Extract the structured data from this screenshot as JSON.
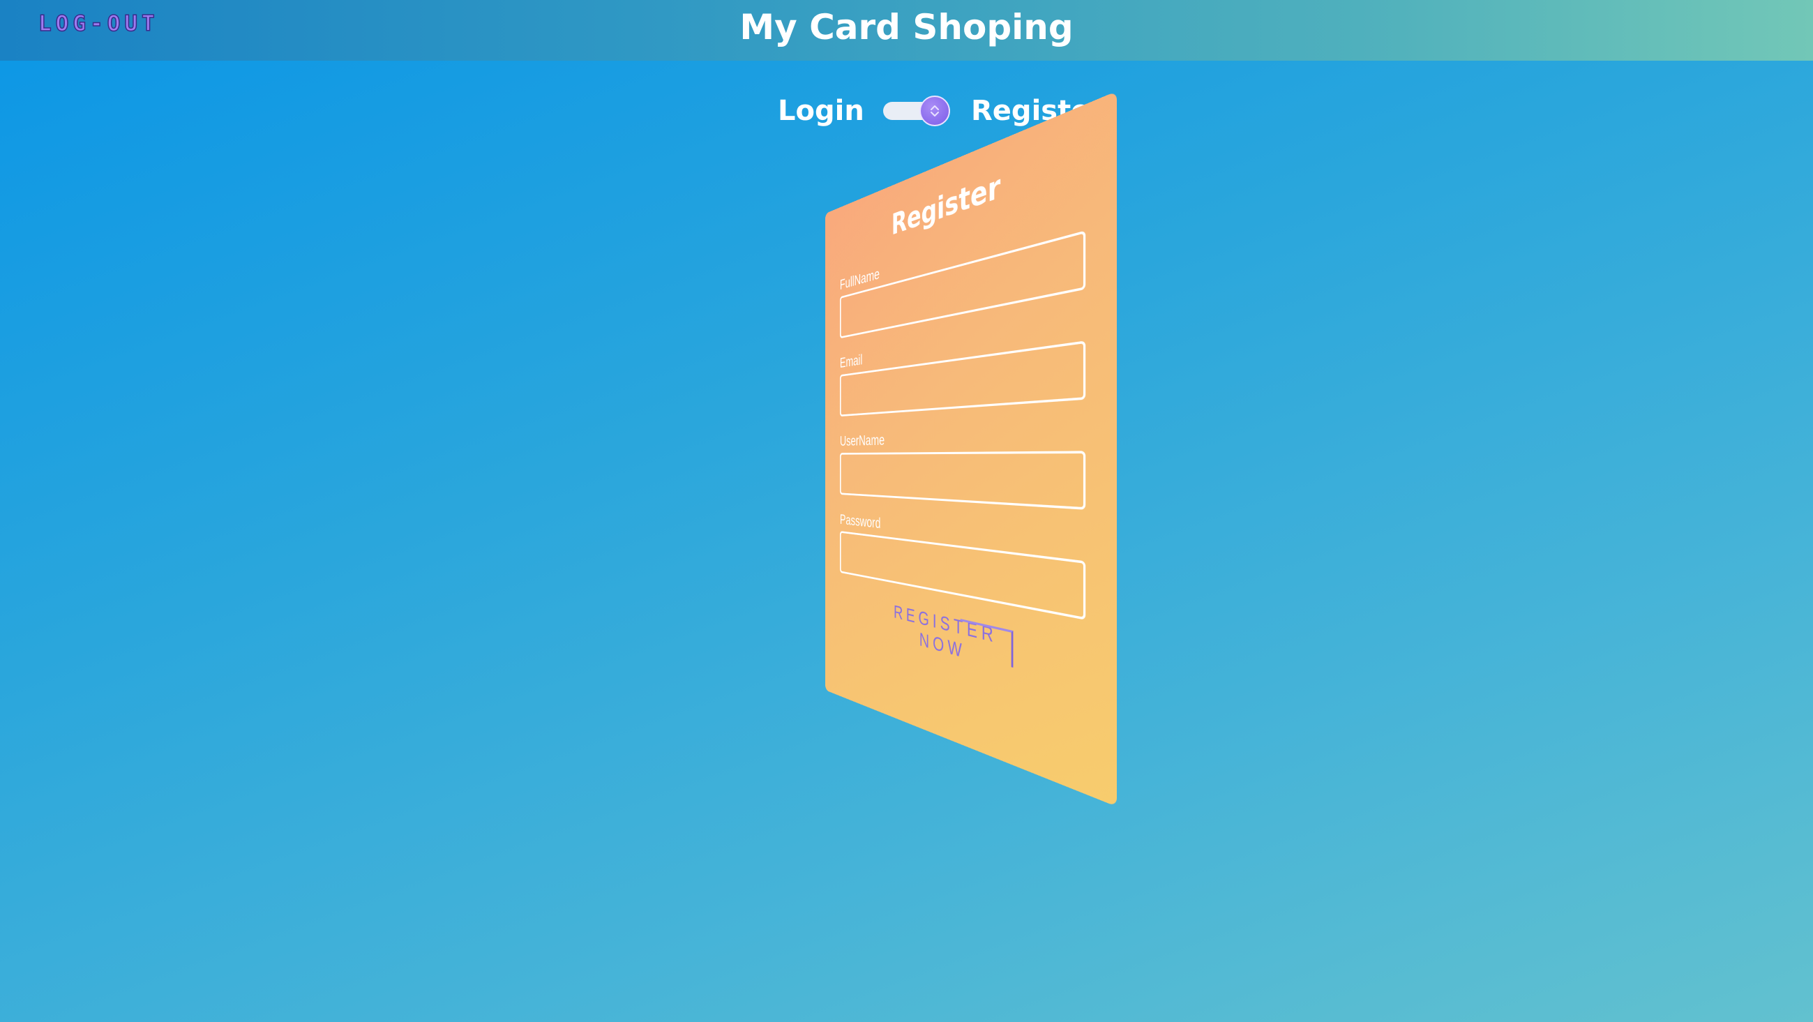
{
  "header": {
    "logout_label": "LOG-OUT",
    "title": "My Card Shoping"
  },
  "mode_switch": {
    "left_label": "Login",
    "right_label": "Register",
    "selected": "Register",
    "knob_icon": "swap-arrows-icon"
  },
  "form": {
    "title": "Register",
    "fields": [
      {
        "label": "FullName",
        "value": "",
        "placeholder": ""
      },
      {
        "label": "Email",
        "value": "",
        "placeholder": ""
      },
      {
        "label": "UserName",
        "value": "",
        "placeholder": ""
      },
      {
        "label": "Password",
        "value": "",
        "placeholder": ""
      }
    ],
    "submit_label": "REGISTER NOW"
  },
  "colors": {
    "background_start": "#0b96e6",
    "background_end": "#62c1cf",
    "card_start": "#f9a97c",
    "card_end": "#f7cc6d",
    "accent": "#8a6fe0",
    "logout": "#9d7bf0"
  }
}
